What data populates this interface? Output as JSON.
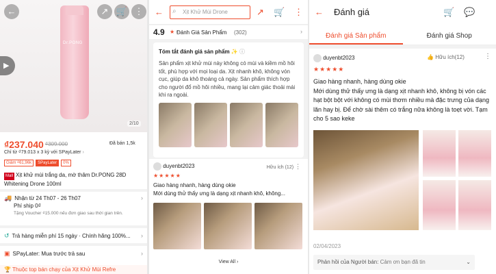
{
  "product": {
    "image_counter": "2/10",
    "brand_on_bottle": "Dr.PONG",
    "price": "₫237.040",
    "old_price": "₫309.000",
    "sold": "Đã bán 1,5k",
    "paylater_text": "Chỉ từ ₫79.013 x 3 kỳ với SPayLater",
    "tag_discount": "Giảm ₫61,96k",
    "tag_spaylater": "SPayLater",
    "tag_percent": "0%",
    "mall_badge": "Mall",
    "title": "Xịt khử mùi trắng da, mờ thâm Dr.PONG 28D Whitening Drone 100ml",
    "delivery": "Nhận từ 24 Th07 - 26 Th07",
    "shipping": "Phí ship 0₫",
    "voucher": "Tặng Voucher ₫15.000 nếu đơn giao sau thời gian trên.",
    "returns": "Trả hàng miễn phí 15 ngày",
    "authentic": "Chính hãng 100%...",
    "spaylater": "SPayLater: Mua trước trả sau",
    "bestseller": "Thuộc top bán chạy của Xịt Khử Mùi Refre"
  },
  "reviews_page": {
    "search_placeholder": "Xịt Khử Mùi Drone",
    "rating": "4.9",
    "rating_label": "Đánh Giá Sản Phẩm",
    "rating_count": "(302)",
    "summary_title": "Tóm tắt đánh giá sản phẩm",
    "summary_ai": "✨",
    "summary_body": "Sản phẩm xịt khử mùi này không có mùi và kiềm mồ hôi tốt, phù hợp với mọi loại da. Xịt nhanh khô, không vón cục, giúp da khô thoáng cả ngày. Sản phẩm thích hợp cho người đổ mồ hôi nhiều, mang lại cảm giác thoải mái khi ra ngoài.",
    "reviewer": "duyenbt2023",
    "helpful": "Hữu ích (12)",
    "stars": "★★★★★",
    "review_line1": "Giao hàng nhanh, hàng dùng okie",
    "review_line2": "Mới dùng thử thấy ưng là dạng xịt nhanh khô, không...",
    "view_all": "View All"
  },
  "review_detail": {
    "title": "Đánh giá",
    "tab_product": "Đánh giá Sản phẩm",
    "tab_shop": "Đánh giá Shop",
    "reviewer": "duyenbt2023",
    "helpful": "Hữu ích(12)",
    "stars": "★★★★★",
    "line1": "Giao hàng nhanh, hàng dùng okie",
    "body": "Mới dùng thử thấy ưng là dạng xịt nhanh khô, không bị vón các hạt bột bột với không có mùi thơm nhiều mà đặc trưng của dạng lăn hay bị. Để chờ sài thêm có trắng nữa không là toẹt vời. Tạm cho 5 sao keke",
    "date": "02/04/2023",
    "seller_reply_label": "Phản hồi của Người bán:",
    "seller_reply": "Cảm ơn bạn đã tin"
  },
  "colors": {
    "accent": "#ee4d2d",
    "teal": "#26aa99"
  }
}
